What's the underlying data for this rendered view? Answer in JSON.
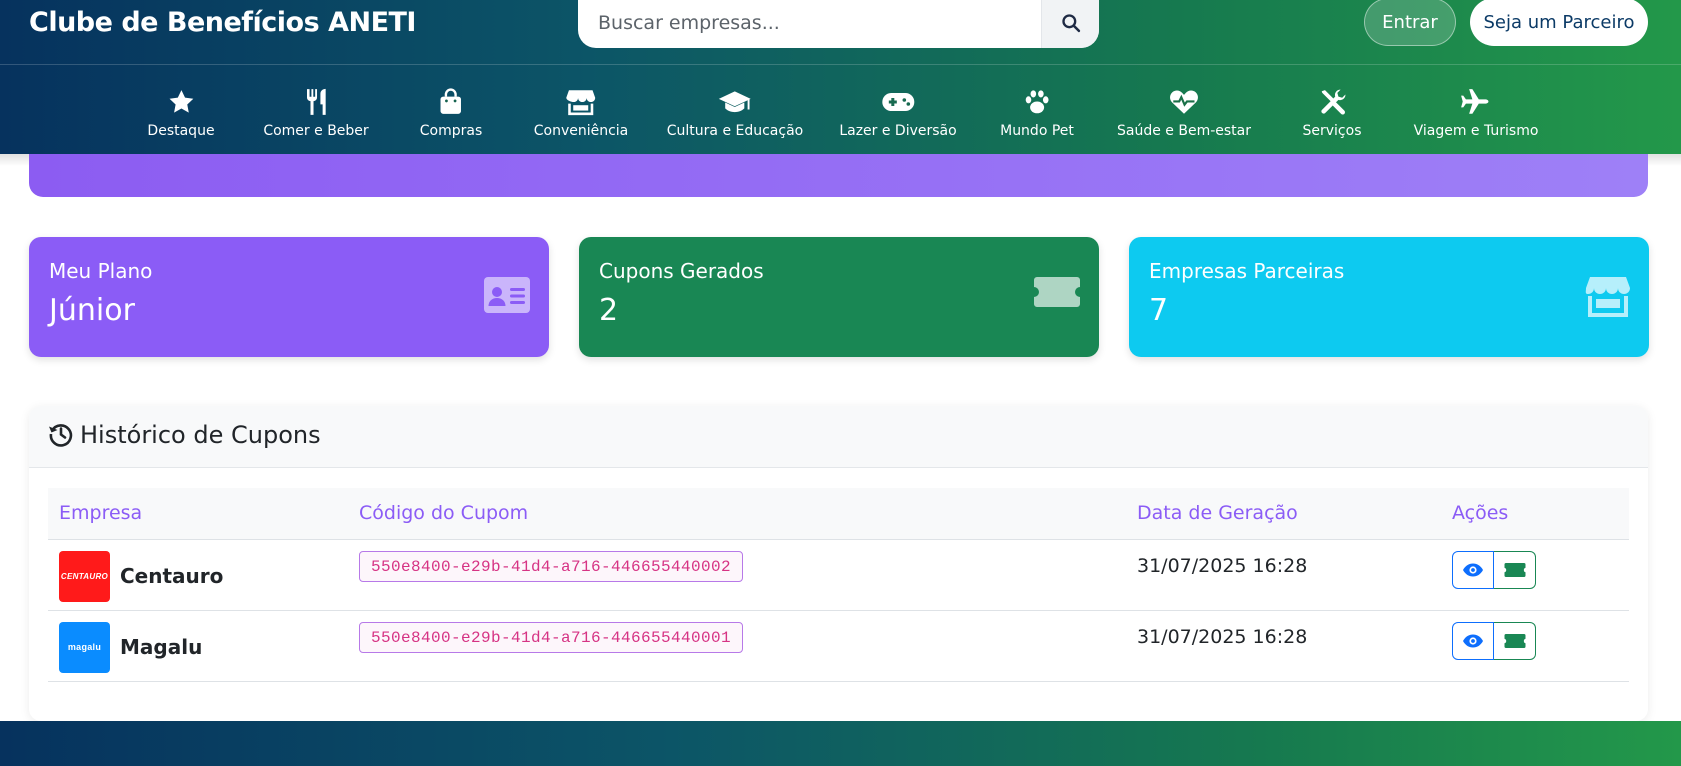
{
  "header": {
    "brand": "Clube de Benefícios ANETI",
    "search": {
      "placeholder": "Buscar empresas..."
    },
    "login_label": "Entrar",
    "partner_label": "Seja um Parceiro"
  },
  "nav": {
    "items": [
      {
        "label": "Destaque",
        "icon": "star-icon"
      },
      {
        "label": "Comer e Beber",
        "icon": "utensils-icon"
      },
      {
        "label": "Compras",
        "icon": "shopping-bag-icon"
      },
      {
        "label": "Conveniência",
        "icon": "store-icon"
      },
      {
        "label": "Cultura e Educação",
        "icon": "graduation-cap-icon"
      },
      {
        "label": "Lazer e Diversão",
        "icon": "gamepad-icon"
      },
      {
        "label": "Mundo Pet",
        "icon": "paw-icon"
      },
      {
        "label": "Saúde e Bem-estar",
        "icon": "heart-pulse-icon"
      },
      {
        "label": "Serviços",
        "icon": "tools-icon"
      },
      {
        "label": "Viagem e Turismo",
        "icon": "plane-icon"
      }
    ]
  },
  "stats": [
    {
      "title": "Meu Plano",
      "value": "Júnior",
      "icon": "id-card-icon",
      "color": "#8b5cf6"
    },
    {
      "title": "Cupons Gerados",
      "value": "2",
      "icon": "ticket-icon",
      "color": "#198754"
    },
    {
      "title": "Empresas Parceiras",
      "value": "7",
      "icon": "store-icon",
      "color": "#0dcaf0"
    }
  ],
  "history": {
    "title": "Histórico de Cupons",
    "columns": [
      "Empresa",
      "Código do Cupom",
      "Data de Geração",
      "Ações"
    ],
    "rows": [
      {
        "company": "Centauro",
        "logo_text": "CENTAURO",
        "logo_color": "#ff1a1a",
        "code": "550e8400-e29b-41d4-a716-446655440002",
        "date": "31/07/2025 16:28"
      },
      {
        "company": "Magalu",
        "logo_text": "magalu",
        "logo_color": "#0a8cff",
        "code": "550e8400-e29b-41d4-a716-446655440001",
        "date": "31/07/2025 16:28"
      }
    ]
  },
  "colors": {
    "accent_purple": "#8b5cf6",
    "success_green": "#198754",
    "info_cyan": "#0dcaf0",
    "code_pink": "#d63384",
    "header_dark_blue": "#06325e",
    "header_green": "#23984a"
  }
}
